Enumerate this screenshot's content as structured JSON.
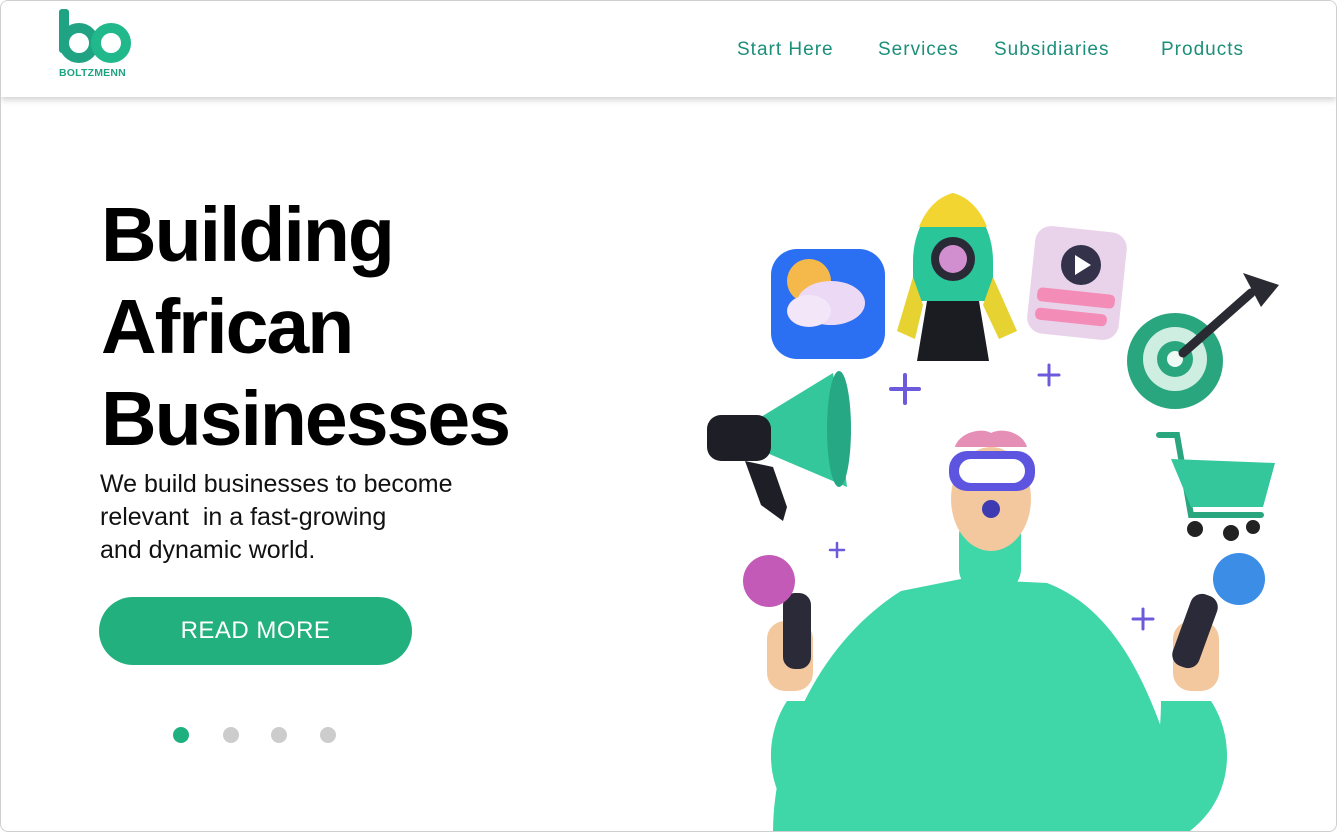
{
  "brand": {
    "name": "BOLTZMENN",
    "color": "#1fa382"
  },
  "nav": {
    "items": [
      {
        "label": "Start Here"
      },
      {
        "label": "Services"
      },
      {
        "label": "Subsidiaries"
      },
      {
        "label": "Products"
      }
    ]
  },
  "hero": {
    "title_lines": [
      "Building",
      "African",
      "Businesses"
    ],
    "subtitle_lines": [
      "We build businesses to become",
      "relevant  in a fast-growing",
      "and dynamic world."
    ],
    "cta_label": "READ MORE"
  },
  "carousel": {
    "total": 4,
    "active_index": 0
  },
  "colors": {
    "accent": "#22b07f",
    "nav_text": "#1c8f7a",
    "dot_inactive": "#cccccc"
  },
  "illustration": {
    "icons": [
      "weather-icon",
      "rocket-icon",
      "video-card-icon",
      "target-dart-icon",
      "megaphone-icon",
      "shopping-cart-icon",
      "vr-headset-person"
    ]
  }
}
